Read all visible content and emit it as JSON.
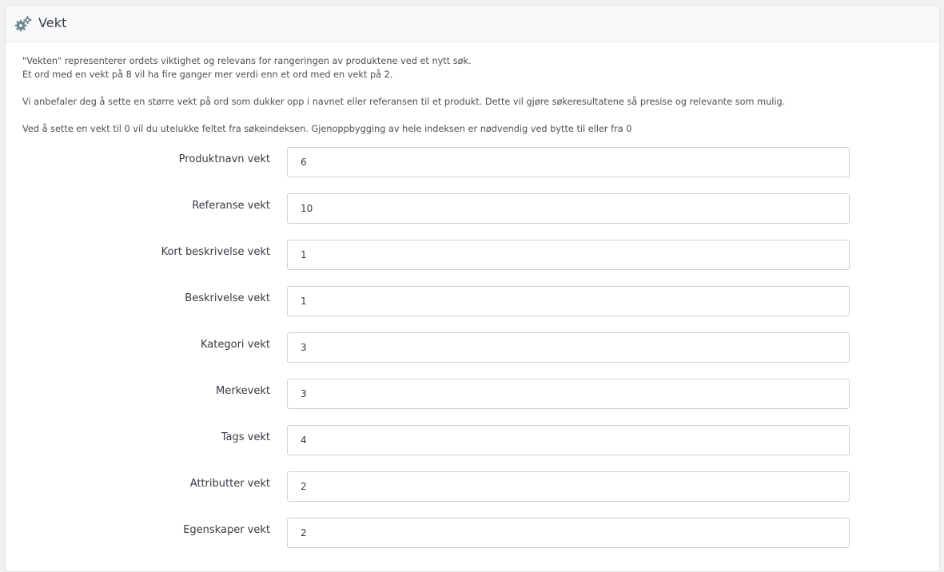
{
  "panel": {
    "title": "Vekt",
    "icon": "cogs-icon"
  },
  "help": {
    "line1": "\"Vekten\" representerer ordets viktighet og relevans for rangeringen av produktene ved et nytt søk.",
    "line2": "Et ord med en vekt på 8 vil ha fire ganger mer verdi enn et ord med en vekt på 2.",
    "line3": "Vi anbefaler deg å sette en større vekt på ord som dukker opp i navnet eller referansen til et produkt. Dette vil gjøre søkeresultatene så presise og relevante som mulig.",
    "line4": "Ved å sette en vekt til 0 vil du utelukke feltet fra søkeindeksen. Gjenoppbygging av hele indeksen er nødvendig ved bytte til eller fra 0"
  },
  "fields": [
    {
      "label": "Produktnavn vekt",
      "value": "6"
    },
    {
      "label": "Referanse vekt",
      "value": "10"
    },
    {
      "label": "Kort beskrivelse vekt",
      "value": "1"
    },
    {
      "label": "Beskrivelse vekt",
      "value": "1"
    },
    {
      "label": "Kategori vekt",
      "value": "3"
    },
    {
      "label": "Merkevekt",
      "value": "3"
    },
    {
      "label": "Tags vekt",
      "value": "4"
    },
    {
      "label": "Attributter vekt",
      "value": "2"
    },
    {
      "label": "Egenskaper vekt",
      "value": "2"
    }
  ]
}
